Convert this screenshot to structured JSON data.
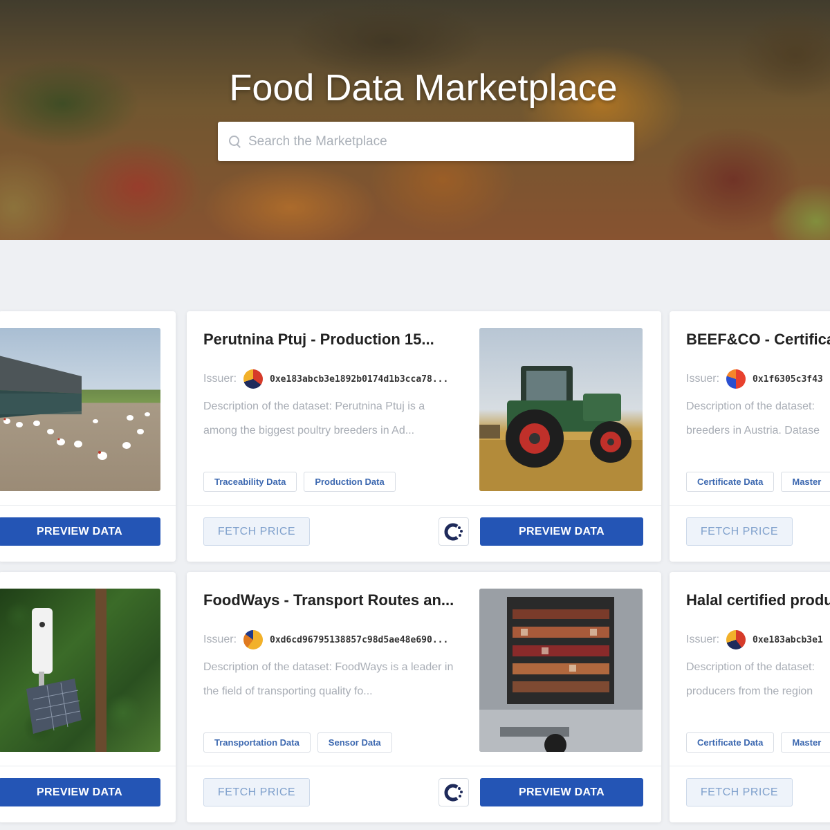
{
  "hero": {
    "title": "Food Data Marketplace",
    "search_placeholder": "Search the Marketplace"
  },
  "colors": {
    "primary_button": "#2455b5",
    "tag_text": "#3c68b0",
    "fetch_text": "#7fa0cc"
  },
  "labels": {
    "issuer": "Issuer:",
    "fetch_price": "FETCH PRICE",
    "preview_data": "PREVIEW DATA"
  },
  "row1": {
    "left_card": {
      "image": "poultry-farm-image",
      "preview_label": "PREVIEW DATA"
    },
    "main_card": {
      "title": "Perutnina Ptuj - Production 15...",
      "issuer_address": "0xe183abcb3e1892b0174d1b3cca78...",
      "description_line1": "Description of the dataset: Perutnina Ptuj is a",
      "description_line2": "among the biggest poultry breeders in Ad...",
      "tags": [
        "Traceability Data",
        "Production Data"
      ],
      "image": "tractor-image"
    },
    "right_card": {
      "title": "BEEF&CO - Certifica",
      "issuer_address": "0x1f6305c3f43",
      "description_line1": "Description of the dataset:",
      "description_line2": "breeders in Austria. Datase",
      "tags": [
        "Certificate Data",
        "Master"
      ]
    }
  },
  "row2": {
    "left_card": {
      "image": "field-sensor-image",
      "preview_label": "PREVIEW DATA"
    },
    "main_card": {
      "title": "FoodWays - Transport Routes an...",
      "issuer_address": "0xd6cd96795138857c98d5ae48e690...",
      "description_line1": "Description of the dataset: FoodWays is a leader in",
      "description_line2": "the field of transporting quality fo...",
      "tags": [
        "Transportation Data",
        "Sensor Data"
      ],
      "image": "delivery-truck-image"
    },
    "right_card": {
      "title": "Halal certified produ",
      "issuer_address": "0xe183abcb3e1",
      "description_line1": "Description of the dataset:",
      "description_line2": "producers from the region",
      "tags": [
        "Certificate Data",
        "Master"
      ]
    }
  }
}
